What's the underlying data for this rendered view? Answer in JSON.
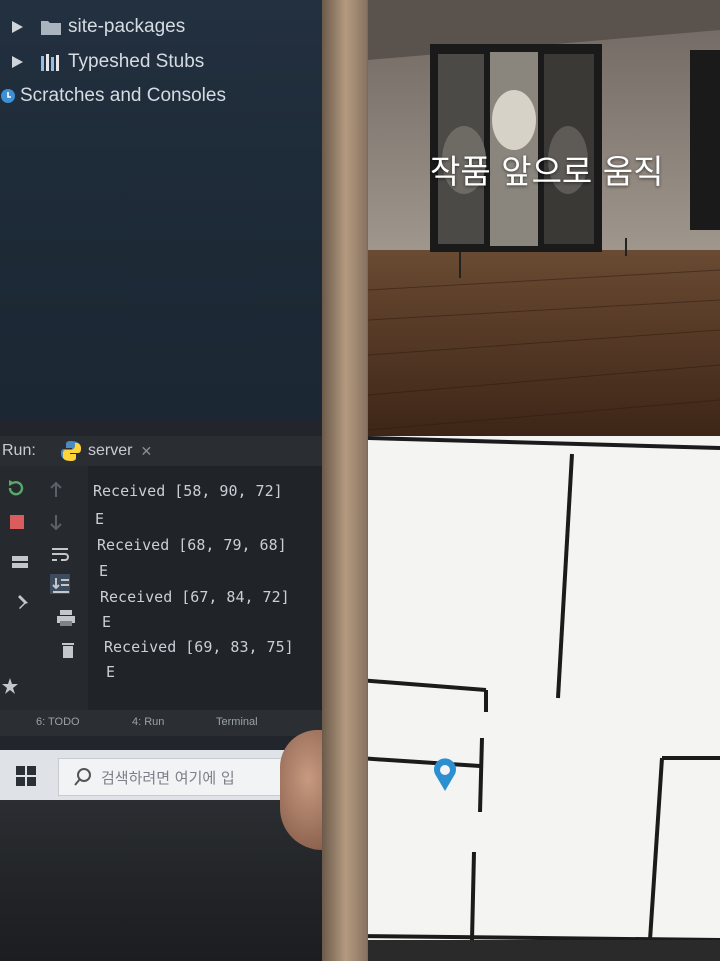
{
  "ide": {
    "tree": [
      {
        "label": "site-packages",
        "icon": "folder-icon"
      },
      {
        "label": "Typeshed Stubs",
        "icon": "library-icon"
      },
      {
        "label": "Scratches and Consoles",
        "icon": "scratches-icon"
      }
    ],
    "run_label": "Run:",
    "run_tab": "server",
    "console_lines": [
      "Received [58, 90, 72]",
      "E",
      "Received [68, 79, 68]",
      "E",
      "Received [67, 84, 72]",
      "E",
      "Received [69, 83, 75]",
      "E"
    ],
    "bottom_tabs": [
      "6: TODO",
      "4: Run",
      "Terminal"
    ]
  },
  "taskbar": {
    "search_placeholder": "검색하려면 여기에 입"
  },
  "phone": {
    "overlay_text": "작품 앞으로 움직",
    "pin_color": "#2c8fd0"
  }
}
